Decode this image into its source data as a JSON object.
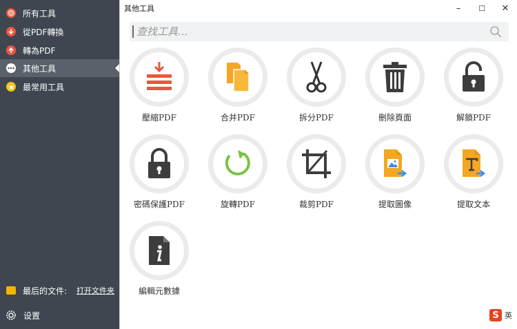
{
  "sidebar": {
    "items": [
      {
        "label": "所有工具"
      },
      {
        "label": "從PDF轉換"
      },
      {
        "label": "轉為PDF"
      },
      {
        "label": "其他工具"
      },
      {
        "label": "最常用工具"
      }
    ],
    "recent_label": "最后的文件:",
    "open_folder": "打开文件夹",
    "settings": "设置"
  },
  "window": {
    "title": "其他工具",
    "min": "–",
    "max": "☐",
    "close": "✕"
  },
  "search": {
    "placeholder": "查找工具..."
  },
  "tools": [
    {
      "label": "壓縮PDF"
    },
    {
      "label": "合并PDF"
    },
    {
      "label": "拆分PDF"
    },
    {
      "label": "刪除頁面"
    },
    {
      "label": "解鎖PDF"
    },
    {
      "label": "密碼保護PDF"
    },
    {
      "label": "旋轉PDF"
    },
    {
      "label": "裁剪PDF"
    },
    {
      "label": "提取圖像"
    },
    {
      "label": "提取文本"
    },
    {
      "label": "編輯元數據"
    }
  ],
  "ime": {
    "logo": "S",
    "text": "英"
  },
  "colors": {
    "sidebar": "#3f4650",
    "active": "#5a616b",
    "red": "#e9573f",
    "orange": "#f5a623",
    "green": "#7cc242",
    "dark": "#3d3d3d",
    "blue": "#3a8ee6"
  }
}
